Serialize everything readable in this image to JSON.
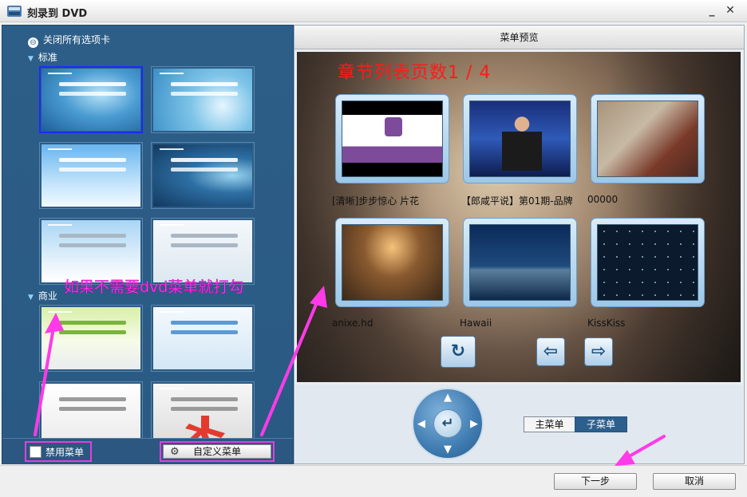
{
  "window": {
    "title": "刻录到 DVD",
    "minimize": "_",
    "close": "✕"
  },
  "left": {
    "collapse_all": "关闭所有选项卡",
    "groups": [
      {
        "label": "标准"
      },
      {
        "label": "商业"
      }
    ],
    "thumbs_meta": [
      {
        "icon": "template-standard-1",
        "selected": true
      },
      {
        "icon": "template-standard-2"
      },
      {
        "icon": "template-standard-3"
      },
      {
        "icon": "template-standard-4"
      },
      {
        "icon": "template-standard-5"
      },
      {
        "icon": "template-standard-6"
      },
      {
        "icon": "template-business-1"
      },
      {
        "icon": "template-business-2"
      },
      {
        "icon": "template-business-3"
      },
      {
        "icon": "template-business-4"
      }
    ],
    "disable_menu_label": "禁用菜单",
    "custom_menu_label": "自定义菜单",
    "annotation": "如果不需要dvd菜单就打勾"
  },
  "preview": {
    "header": "菜单预览",
    "page_title": "章节列表页数1 / 4",
    "chapters": [
      {
        "label": "[清晰]步步惊心 片花"
      },
      {
        "label": "【郎咸平说】第01期-品牌"
      },
      {
        "label": "00000"
      },
      {
        "label": "anixe.hd"
      },
      {
        "label": "Hawaii"
      },
      {
        "label": "KissKiss"
      }
    ],
    "tabs": {
      "main": "主菜单",
      "sub": "子菜单"
    },
    "colors": {
      "title_red": "#ff1a1a",
      "annotation_pink": "#ff3ae8",
      "panel_blue": "#2d5e88"
    }
  },
  "footer": {
    "next": "下一步",
    "cancel": "取消"
  }
}
